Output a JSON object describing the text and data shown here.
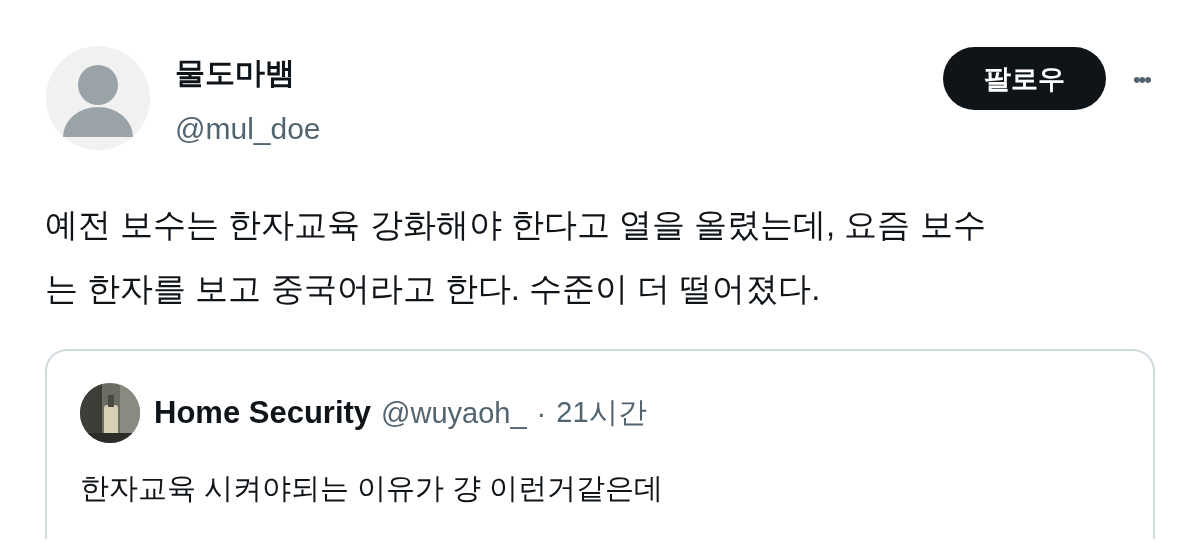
{
  "author": {
    "name": "물도마뱀",
    "handle": "@mul_doe"
  },
  "follow_button": {
    "label": "팔로우"
  },
  "more_button": {
    "label": "•••"
  },
  "tweet": {
    "text_lines": [
      "예전 보수는 한자교육 강화해야 한다고 열을 올렸는데, 요즘 보수",
      "는 한자를 보고 중국어라고 한다. 수준이 더 떨어졌다."
    ]
  },
  "quote": {
    "name": "Home Security",
    "handle": "@wuyaoh_",
    "separator": "·",
    "time": "21시간",
    "text": "한자교육 시켜야되는 이유가 걍 이런거같은데"
  }
}
